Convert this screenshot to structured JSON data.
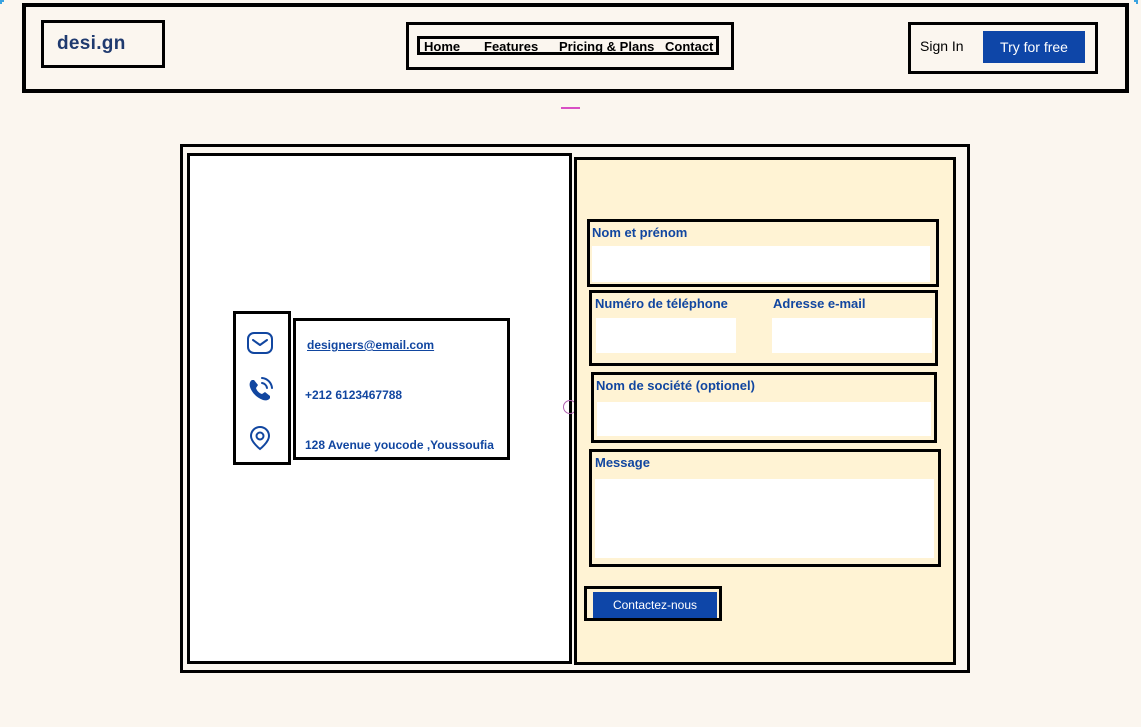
{
  "header": {
    "logo": "desi.gn",
    "nav": [
      {
        "label": "Home"
      },
      {
        "label": "Features"
      },
      {
        "label": "Pricing & Plans"
      },
      {
        "label": "Contact"
      }
    ],
    "sign_in": "Sign In",
    "cta": "Try for free"
  },
  "contact_info": {
    "email": "designers@email.com",
    "phone": "+212 6123467788",
    "address": "128 Avenue youcode ,Youssoufia",
    "icons": [
      "mail-icon",
      "phone-icon",
      "location-pin-icon"
    ]
  },
  "form": {
    "name_label": "Nom et prénom",
    "phone_label": "Numéro de téléphone",
    "email_label": "Adresse e-mail",
    "company_label": "Nom de société (optionel)",
    "message_label": "Message",
    "submit_label": "Contactez-nous",
    "name_value": "",
    "phone_value": "",
    "email_value": "",
    "company_value": "",
    "message_value": ""
  },
  "colors": {
    "background": "#fbf6ef",
    "accent": "#0e46a8",
    "label": "#1146a0",
    "form_panel": "#fff3d4"
  }
}
